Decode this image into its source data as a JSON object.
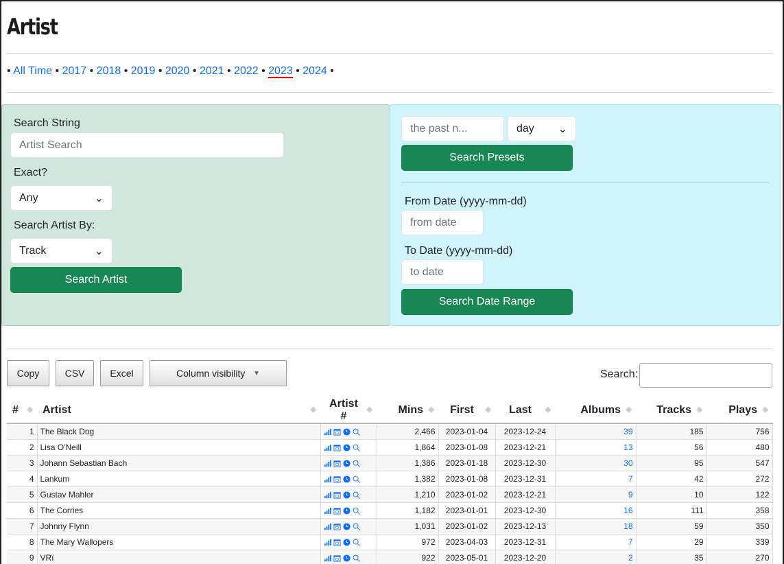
{
  "title": "Artist",
  "years": [
    "All Time",
    "2017",
    "2018",
    "2019",
    "2020",
    "2021",
    "2022",
    "2023",
    "2024"
  ],
  "active_year": "2023",
  "left_panel": {
    "search_label": "Search String",
    "search_placeholder": "Artist Search",
    "exact_label": "Exact?",
    "exact_value": "Any",
    "by_label": "Search Artist By:",
    "by_value": "Track",
    "button": "Search Artist"
  },
  "right_panel": {
    "past_placeholder": "the past n...",
    "unit_value": "day",
    "presets_button": "Search Presets",
    "from_label": "From Date (yyyy-mm-dd)",
    "from_placeholder": "from date",
    "to_label": "To Date (yyyy-mm-dd)",
    "to_placeholder": "to date",
    "range_button": "Search Date Range"
  },
  "toolbar": {
    "copy": "Copy",
    "csv": "CSV",
    "excel": "Excel",
    "colvis": "Column visibility",
    "search_label": "Search:"
  },
  "colors": {
    "green": "#198754",
    "green_panel": "#d1e7dd",
    "cyan_panel": "#cff4fc",
    "link": "#0d6efd"
  },
  "table": {
    "headers": [
      "#",
      "Artist",
      "Artist #",
      "Mins",
      "First",
      "Last",
      "Albums",
      "Tracks",
      "Plays"
    ],
    "row_icons": [
      "bar-chart-icon",
      "calendar-icon",
      "clock-icon",
      "search-icon"
    ],
    "rows": [
      [
        "1",
        "The Black Dog",
        "2,466",
        "2023-01-04",
        "2023-12-24",
        "39",
        "185",
        "756"
      ],
      [
        "2",
        "Lisa O'Neill",
        "1,864",
        "2023-01-08",
        "2023-12-21",
        "13",
        "56",
        "480"
      ],
      [
        "3",
        "Johann Sebastian Bach",
        "1,386",
        "2023-01-18",
        "2023-12-30",
        "30",
        "95",
        "547"
      ],
      [
        "4",
        "Lankum",
        "1,382",
        "2023-01-08",
        "2023-12-31",
        "7",
        "42",
        "272"
      ],
      [
        "5",
        "Gustav Mahler",
        "1,210",
        "2023-01-02",
        "2023-12-21",
        "9",
        "10",
        "122"
      ],
      [
        "6",
        "The Corries",
        "1,182",
        "2023-01-01",
        "2023-12-30",
        "16",
        "111",
        "358"
      ],
      [
        "7",
        "Johnny Flynn",
        "1,031",
        "2023-01-02",
        "2023-12-13",
        "18",
        "59",
        "350"
      ],
      [
        "8",
        "The Mary Wallopers",
        "972",
        "2023-04-03",
        "2023-12-31",
        "7",
        "29",
        "339"
      ],
      [
        "9",
        "VRï",
        "922",
        "2023-05-01",
        "2023-12-20",
        "2",
        "35",
        "270"
      ]
    ]
  }
}
